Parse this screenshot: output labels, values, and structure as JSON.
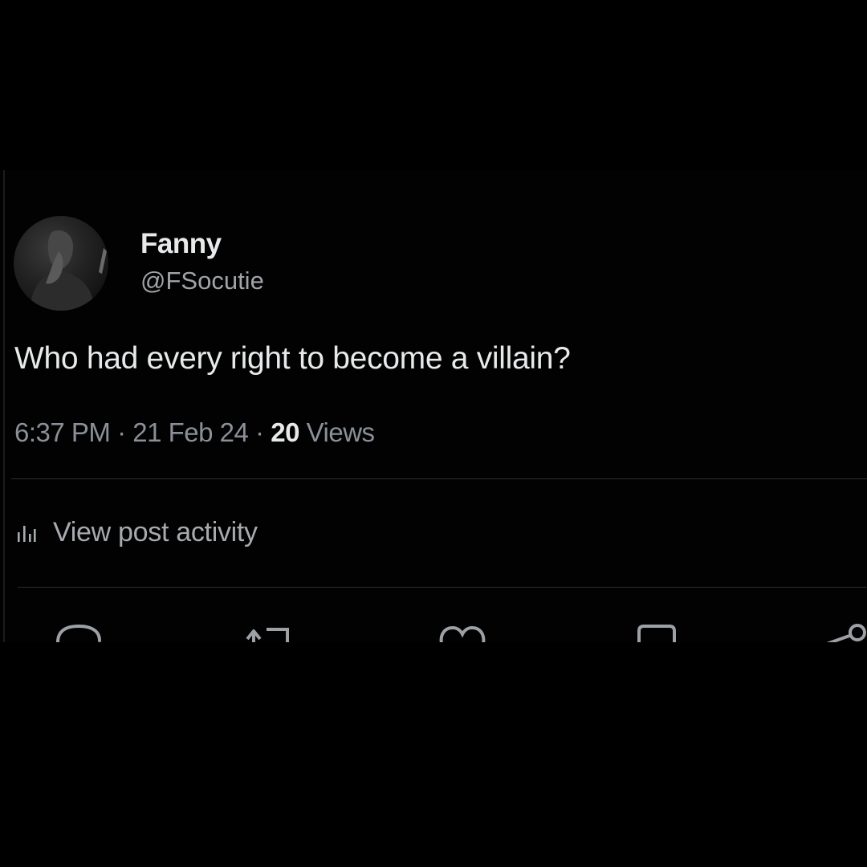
{
  "post": {
    "author": {
      "display_name": "Fanny",
      "handle": "@FSocutie",
      "avatar": "profile-photo"
    },
    "text": "Who had every right to become a villain?",
    "meta": {
      "time": "6:37 PM",
      "separator": "·",
      "date": "21 Feb 24",
      "views_count": "20",
      "views_label": "Views"
    },
    "activity": {
      "icon": "analytics-bar-icon",
      "label": "View post activity"
    },
    "actions": [
      {
        "name": "reply",
        "icon": "reply-icon"
      },
      {
        "name": "repost",
        "icon": "repost-icon"
      },
      {
        "name": "like",
        "icon": "like-icon"
      },
      {
        "name": "bookmark",
        "icon": "bookmark-icon"
      },
      {
        "name": "share",
        "icon": "share-icon"
      }
    ]
  },
  "colors": {
    "background": "#000000",
    "primary_text": "#e7e9ea",
    "secondary_text": "#8b9096",
    "divider": "#2b2f33"
  }
}
